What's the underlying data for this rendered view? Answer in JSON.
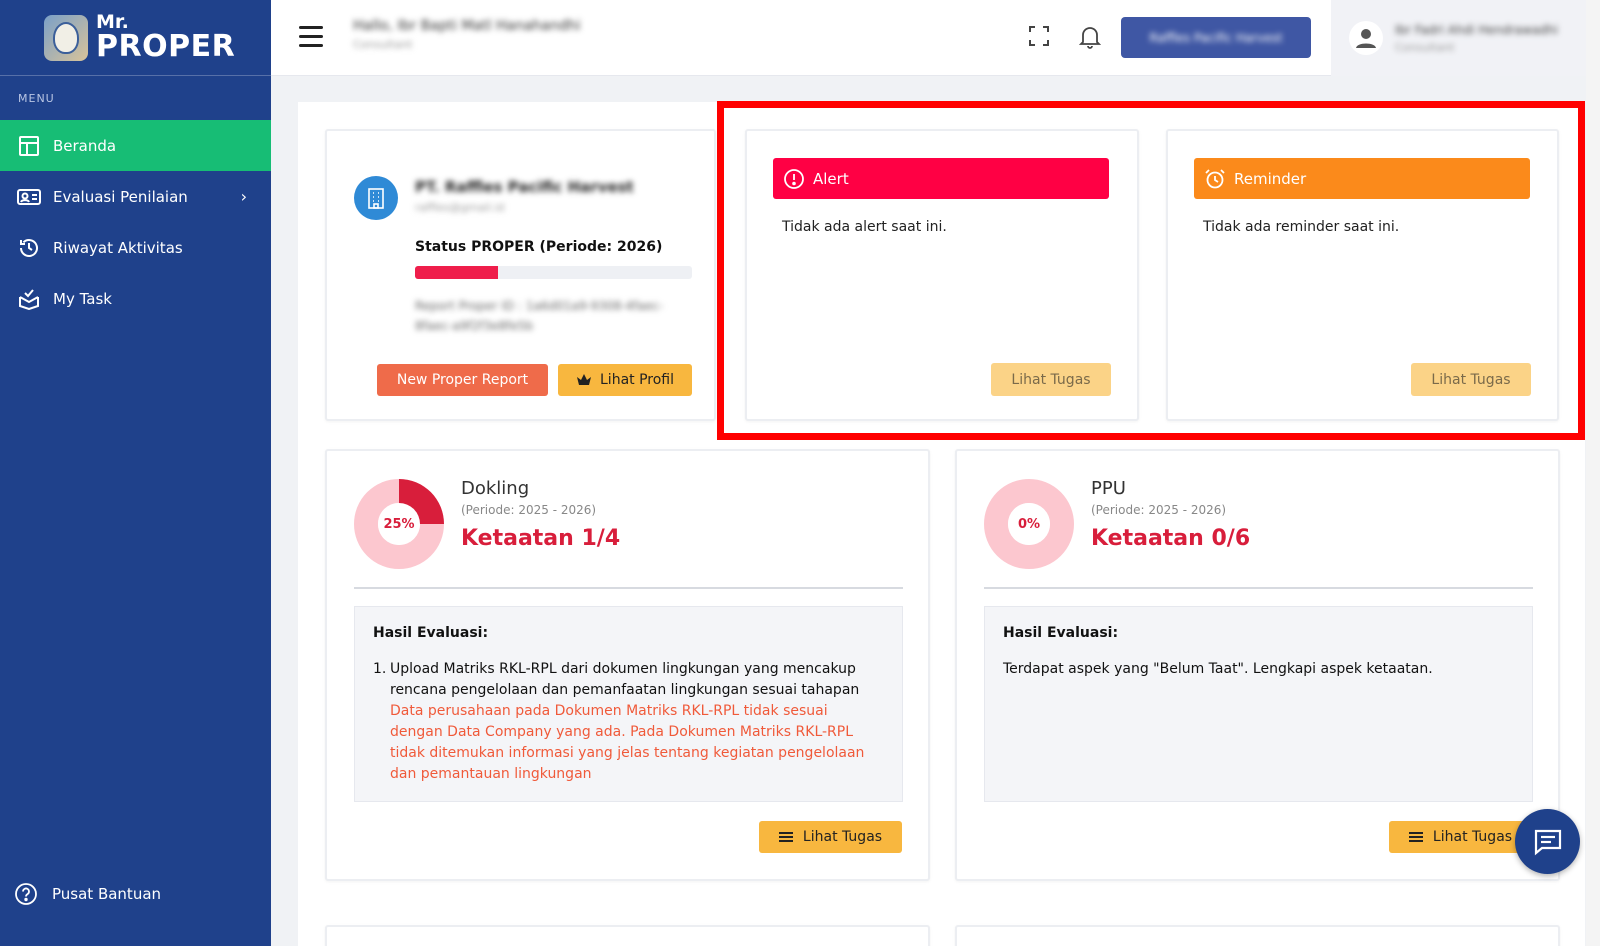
{
  "brand": {
    "mr": "Mr.",
    "proper": "PROPER"
  },
  "sidebar": {
    "menu_label": "MENU",
    "items": [
      {
        "label": "Beranda",
        "icon": "layout-icon",
        "active": true
      },
      {
        "label": "Evaluasi Penilaian",
        "icon": "id-card-icon",
        "has_submenu": true
      },
      {
        "label": "Riwayat Aktivitas",
        "icon": "history-icon"
      },
      {
        "label": "My Task",
        "icon": "task-icon"
      }
    ],
    "help_label": "Pusat Bantuan"
  },
  "topbar": {
    "greeting": "Hallo, Ibr Bapti Matl Hanahandhi",
    "greeting_role": "Consultant",
    "company_button": "Raffles Pacific Harvest",
    "user_name": "Ibr Fadri Ahdi Hendrawadhi",
    "user_role": "Consultant"
  },
  "profile": {
    "company": "PT. Raffles Pacific Harvest",
    "email": "raffles@gmail.id",
    "status_label": "Status PROPER (Periode: 2026)",
    "progress": 0.3,
    "report_id": "Report Proper ID : 1a6d01a9-9308-4faec-8faec-a9f2f3e8fe5b",
    "new_report_label": "New Proper Report",
    "profile_label": "Lihat Profil"
  },
  "alert": {
    "title": "Alert",
    "body": "Tidak ada alert saat ini.",
    "button": "Lihat Tugas"
  },
  "reminder": {
    "title": "Reminder",
    "body": "Tidak ada reminder saat ini.",
    "button": "Lihat Tugas"
  },
  "dokling": {
    "percent_label": "25%",
    "percent": 25,
    "title": "Dokling",
    "period": "(Periode: 2025 - 2026)",
    "compliance": "Ketaatan 1/4",
    "eval_title": "Hasil Evaluasi:",
    "item_number": "1.",
    "item_text": "Upload Matriks RKL-RPL dari dokumen lingkungan yang mencakup rencana pengelolaan dan pemanfaatan lingkungan sesuai tahapan",
    "item_note": "Data perusahaan pada Dokumen Matriks RKL-RPL tidak sesuai dengan Data Company yang ada. Pada Dokumen Matriks RKL-RPL tidak ditemukan informasi yang jelas tentang kegiatan pengelolaan dan pemantauan lingkungan",
    "button": "Lihat Tugas"
  },
  "ppu": {
    "percent_label": "0%",
    "percent": 0,
    "title": "PPU",
    "period": "(Periode: 2025 - 2026)",
    "compliance": "Ketaatan 0/6",
    "eval_title": "Hasil Evaluasi:",
    "eval_text": "Terdapat aspek yang \"Belum Taat\". Lengkapi aspek ketaatan.",
    "button": "Lihat Tugas"
  },
  "colors": {
    "sidebar": "#1f418b",
    "active": "#17bd75",
    "alert": "#ff0044",
    "reminder": "#fb8a1b",
    "accent_red": "#d81e3b",
    "button_yellow": "#f8b73f"
  }
}
